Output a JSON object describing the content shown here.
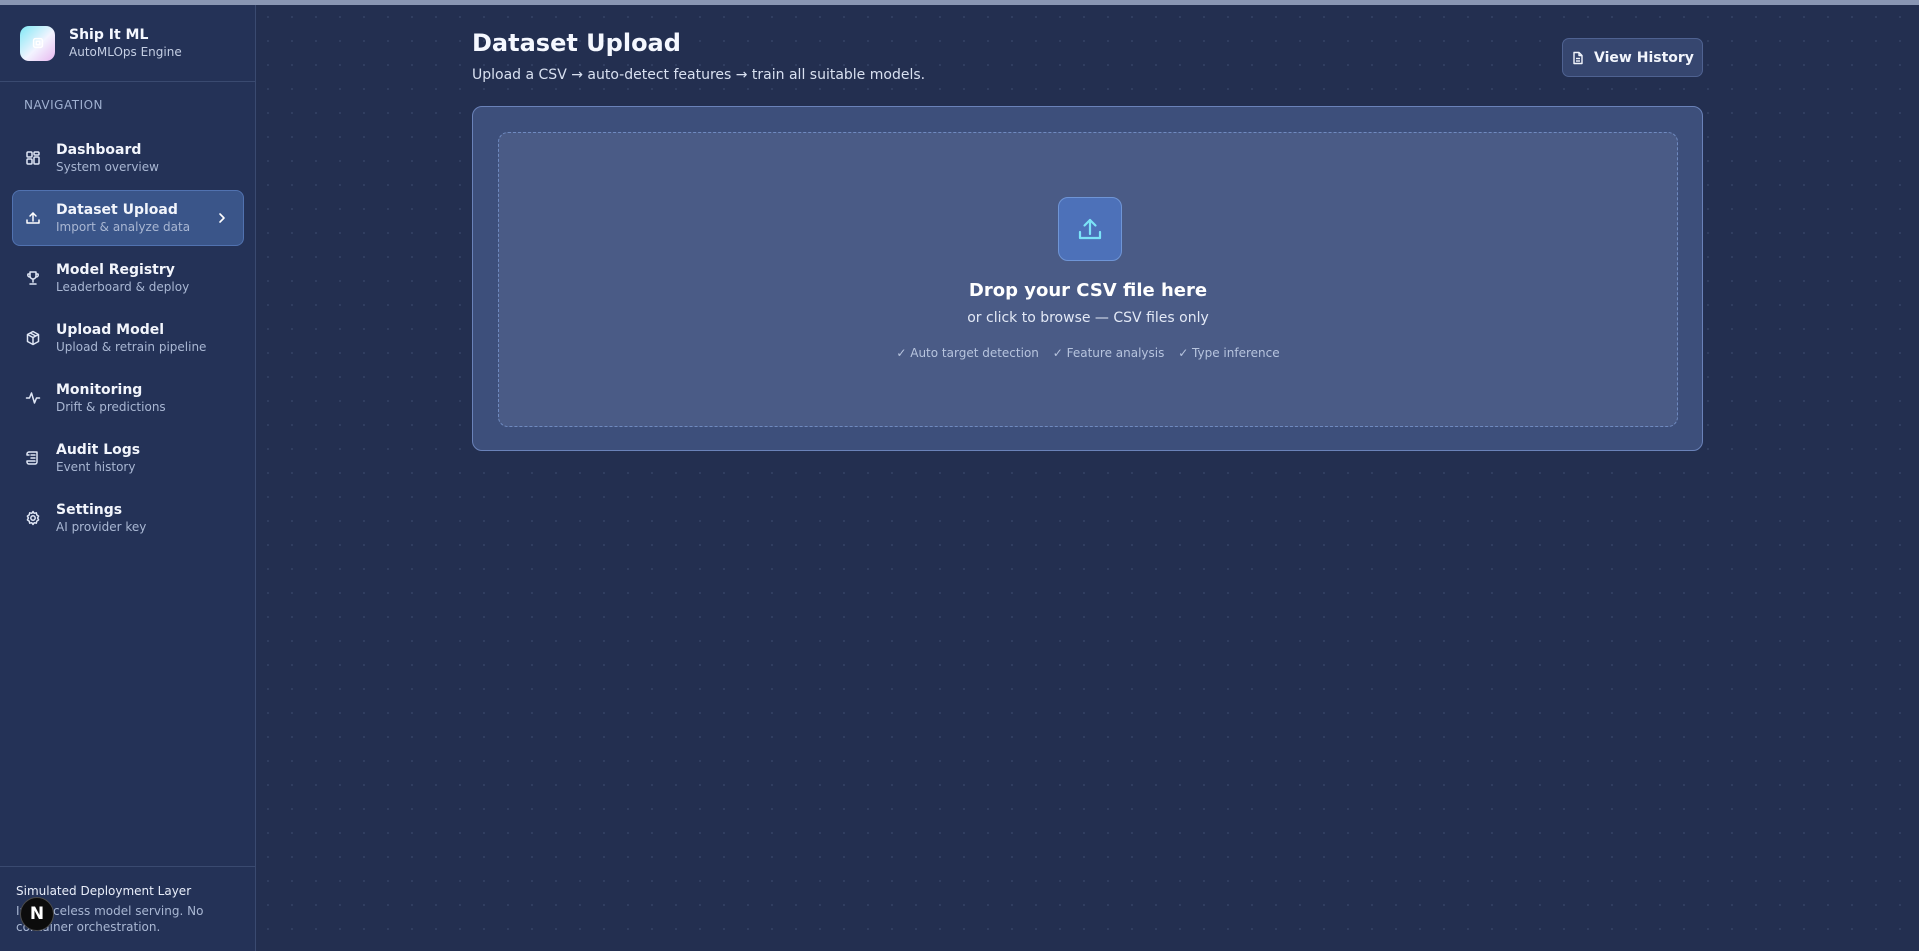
{
  "brand": {
    "name": "Ship It ML",
    "subtitle": "AutoMLOps Engine"
  },
  "nav": {
    "heading": "NAVIGATION",
    "items": [
      {
        "title": "Dashboard",
        "subtitle": "System overview",
        "icon": "dashboard-icon"
      },
      {
        "title": "Dataset Upload",
        "subtitle": "Import & analyze data",
        "icon": "upload-icon",
        "active": true
      },
      {
        "title": "Model Registry",
        "subtitle": "Leaderboard & deploy",
        "icon": "trophy-icon"
      },
      {
        "title": "Upload Model",
        "subtitle": "Upload & retrain pipeline",
        "icon": "package-icon"
      },
      {
        "title": "Monitoring",
        "subtitle": "Drift & predictions",
        "icon": "activity-icon"
      },
      {
        "title": "Audit Logs",
        "subtitle": "Event history",
        "icon": "scroll-icon"
      },
      {
        "title": "Settings",
        "subtitle": "AI provider key",
        "icon": "gear-icon"
      }
    ]
  },
  "footer": {
    "title": "Simulated Deployment Layer",
    "description": "Instanceless model serving. No container orchestration.",
    "badge": "N"
  },
  "page": {
    "title": "Dataset Upload",
    "description": "Upload a CSV → auto-detect features → train all suitable models.",
    "history_button": "View History"
  },
  "dropzone": {
    "title": "Drop your CSV file here",
    "subtitle": "or click to browse — CSV files only",
    "features": [
      "✓ Auto target detection",
      "✓ Feature analysis",
      "✓ Type inference"
    ]
  },
  "colors": {
    "accent": "#5ad0f0",
    "active_nav": "#3a5589",
    "background": "#232f50"
  }
}
